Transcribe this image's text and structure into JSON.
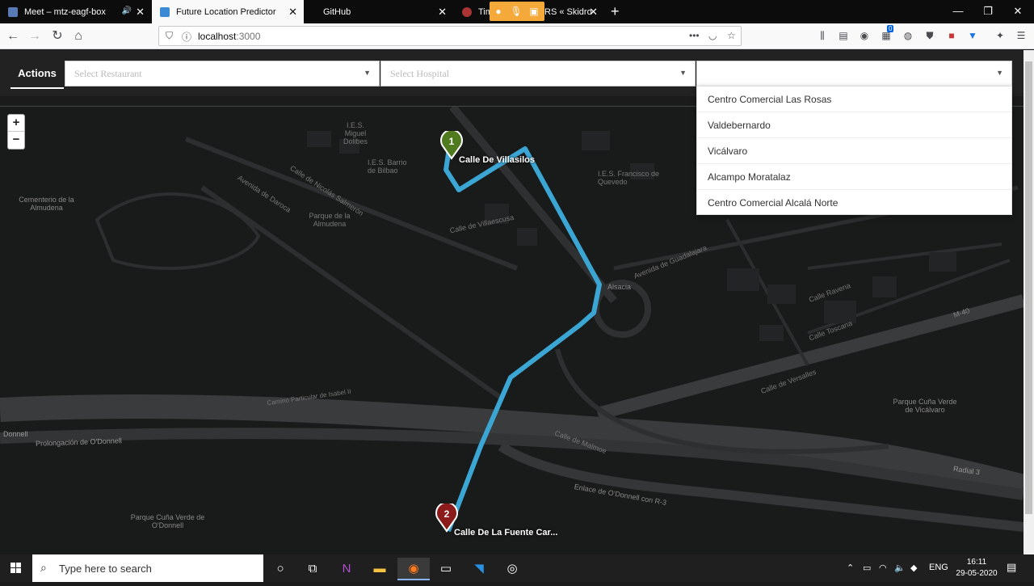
{
  "tabs": [
    {
      "label": "Meet – mtz-eagf-box",
      "icon": "meet-icon",
      "has_audio": true
    },
    {
      "label": "Future Location Predictor",
      "icon": "app-icon",
      "active": true
    },
    {
      "label": "GitHub",
      "icon": "github-icon"
    },
    {
      "label": "Tim",
      "icon": "avatar-icon"
    },
    {
      "label": "RS « Skidro",
      "icon": "page-icon"
    }
  ],
  "nav": {
    "url_host": "localhost",
    "url_port": ":3000"
  },
  "app": {
    "actions_label": "Actions",
    "restaurant_placeholder": "Select Restaurant",
    "hospital_placeholder": "Select Hospital",
    "third_select_value": ""
  },
  "dropdown_options": [
    "Centro Comercial Las Rosas",
    "Valdebernardo",
    "Vicálvaro",
    "Alcampo Moratalaz",
    "Centro Comercial Alcalá Norte"
  ],
  "map": {
    "zoom_in": "+",
    "zoom_out": "−",
    "marker_start_number": "1",
    "marker_start_label": "Calle De Villasilos",
    "marker_end_number": "2",
    "marker_end_label": "Calle De La Fuente Car...",
    "route_color": "#3ba5d4",
    "start_color": "#4f7a1e",
    "end_color": "#8b1a1a",
    "labels": [
      "I.E.S. Miguel Dolibes",
      "I.E.S. Barrio de Bilbao",
      "Calle De Villasilos",
      "I.E.S. Francisco de Quevedo",
      "Cementerio de la Almudena",
      "Calle de Nicolás Salmerón",
      "Avenida de Daroca",
      "Parque de la Almudena",
      "Calle de Villaescusa",
      "Avenida de Guadalajara",
      "Alsacia",
      "Calle Bulgaria",
      "Calle Ravena",
      "Calle Toscana",
      "Calle de Versalles",
      "Calle de Capri",
      "M-40",
      "Parque Cuña Verde de Vicálvaro",
      "Camino Particular de Isabel II",
      "Donnell",
      "Prolongación de O'Donnell",
      "Arco Verde Calleja",
      "Calle de Malmoe",
      "Radial 3",
      "Enlace de O'Donnell con R-3",
      "Parque Cuña Verde de O'Donnell",
      "Carril bici calle O'Donnell",
      "Avenida de Canillejas"
    ]
  },
  "taskbar": {
    "search_text": "Type here to search",
    "lang": "ENG",
    "time": "16:11",
    "date": "29-05-2020",
    "badge": "0"
  }
}
